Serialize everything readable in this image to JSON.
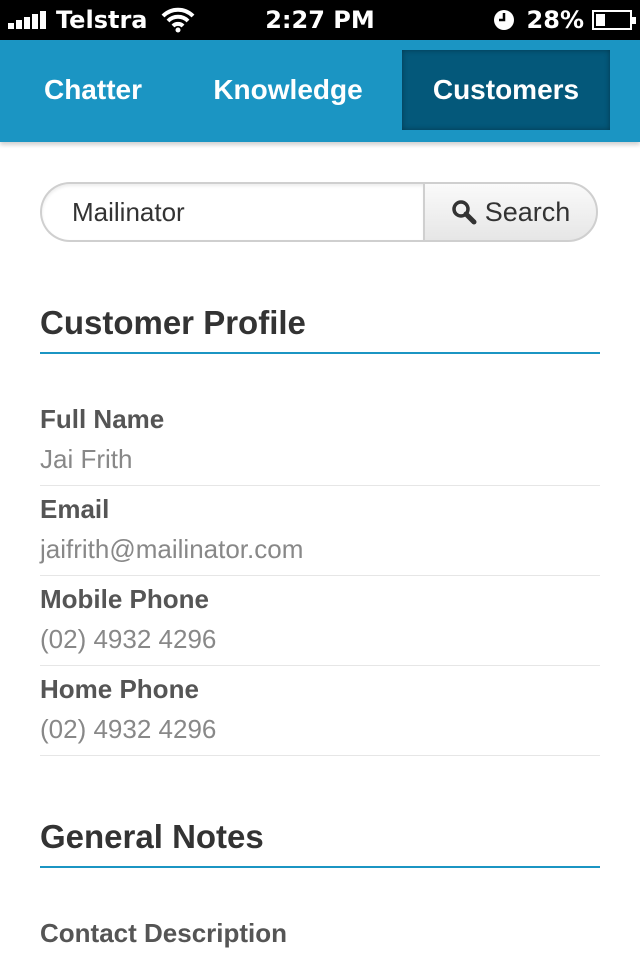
{
  "status_bar": {
    "carrier": "Telstra",
    "time": "2:27 PM",
    "battery_text": "28%",
    "battery_level": 0.28,
    "icons": [
      "signal-icon",
      "wifi-icon",
      "clock-icon",
      "battery-icon"
    ]
  },
  "nav": {
    "tabs": [
      {
        "label": "Chatter",
        "active": false
      },
      {
        "label": "Knowledge",
        "active": false
      },
      {
        "label": "Customers",
        "active": true
      }
    ],
    "colors": {
      "bar": "#1b95c3",
      "active": "#04587a"
    }
  },
  "search": {
    "value": "Mailinator",
    "button_label": "Search",
    "icon": "search-icon"
  },
  "customer_profile": {
    "title": "Customer Profile",
    "fields": [
      {
        "label": "Full Name",
        "value": "Jai Frith"
      },
      {
        "label": "Email",
        "value": "jaifrith@mailinator.com"
      },
      {
        "label": "Mobile Phone",
        "value": "(02) 4932 4296"
      },
      {
        "label": "Home Phone",
        "value": "(02) 4932 4296"
      }
    ]
  },
  "general_notes": {
    "title": "General Notes",
    "fields": [
      {
        "label": "Contact Description",
        "value": ""
      }
    ]
  }
}
